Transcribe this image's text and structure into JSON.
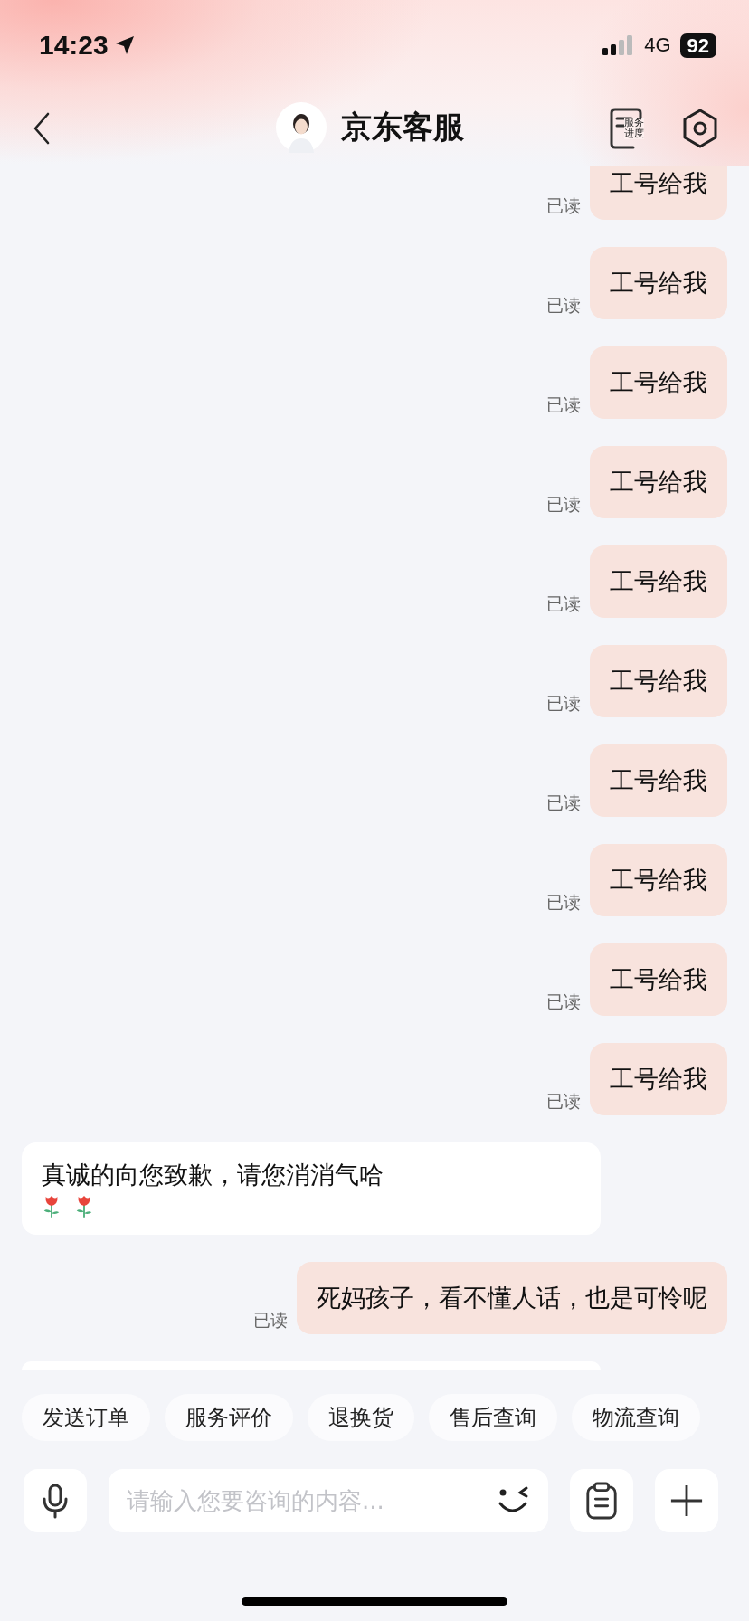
{
  "status_bar": {
    "time": "14:23",
    "network": "4G",
    "battery": "92"
  },
  "header": {
    "title": "京东客服",
    "progress_label": [
      "服务",
      "进度"
    ]
  },
  "messages": [
    {
      "kind": "user",
      "text": "工号给我",
      "read": "已读"
    },
    {
      "kind": "user",
      "text": "工号给我",
      "read": "已读"
    },
    {
      "kind": "user",
      "text": "工号给我",
      "read": "已读"
    },
    {
      "kind": "user",
      "text": "工号给我",
      "read": "已读"
    },
    {
      "kind": "user",
      "text": "工号给我",
      "read": "已读"
    },
    {
      "kind": "user",
      "text": "工号给我",
      "read": "已读"
    },
    {
      "kind": "user",
      "text": "工号给我",
      "read": "已读"
    },
    {
      "kind": "user",
      "text": "工号给我",
      "read": "已读"
    },
    {
      "kind": "user",
      "text": "工号给我",
      "read": "已读"
    },
    {
      "kind": "user",
      "text": "工号给我",
      "read": "已读"
    },
    {
      "kind": "agent",
      "text": "真诚的向您致歉，请您消消气哈",
      "emoji": [
        {
          "kind": "rose"
        },
        {
          "kind": "rose"
        }
      ]
    },
    {
      "kind": "user",
      "text": "死妈孩子，看不懂人话，也是可怜呢",
      "read": "已读"
    }
  ],
  "quick_replies": [
    "发送订单",
    "服务评价",
    "退换货",
    "售后查询",
    "物流查询"
  ],
  "input": {
    "placeholder": "请输入您要咨询的内容..."
  }
}
